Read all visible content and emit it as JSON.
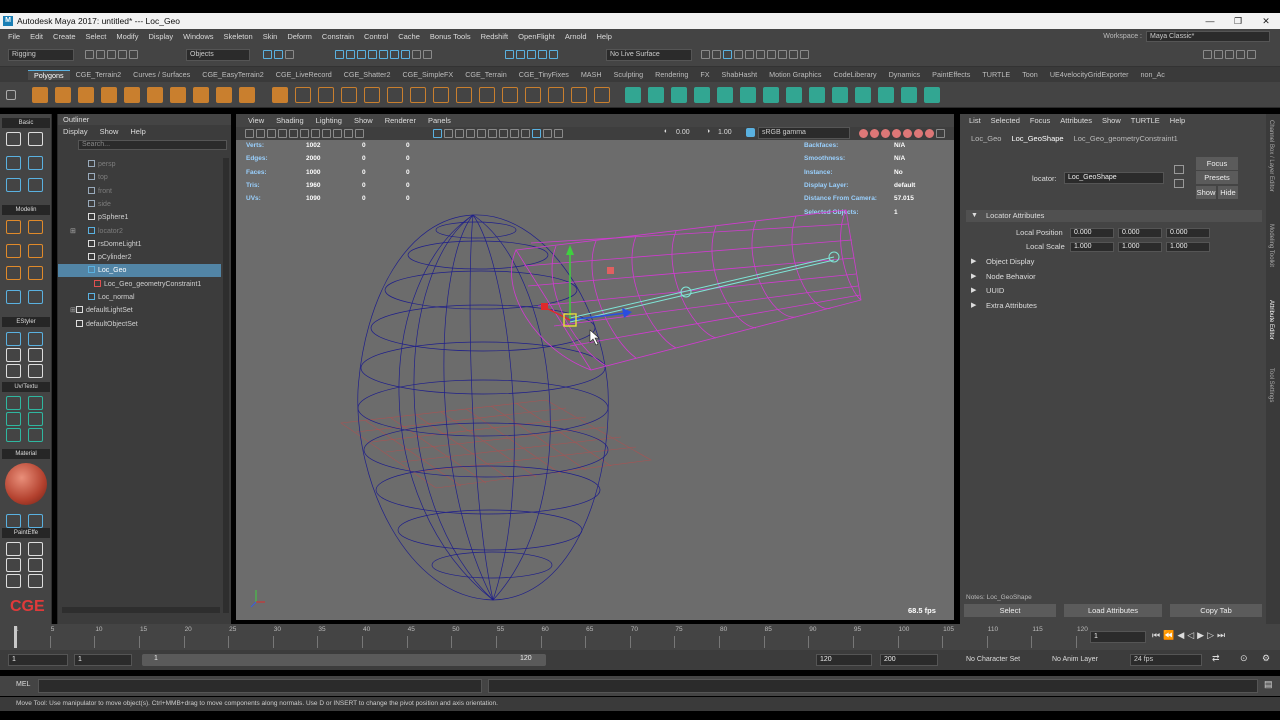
{
  "window": {
    "title": "Autodesk Maya 2017: untitled*   ---   Loc_Geo",
    "controls": [
      "—",
      "❐",
      "✕"
    ]
  },
  "menubar": {
    "items": [
      "File",
      "Edit",
      "Create",
      "Select",
      "Modify",
      "Display",
      "Windows",
      "Skeleton",
      "Skin",
      "Deform",
      "Constrain",
      "Control",
      "Cache",
      "Bonus Tools",
      "Redshift",
      "OpenFlight",
      "Arnold",
      "Help"
    ],
    "workspace_label": "Workspace :",
    "workspace_value": "Maya Classic*"
  },
  "statusline": {
    "mode": "Rigging",
    "selection_mask": "Objects",
    "live_surface": "No Live Surface"
  },
  "shelf": {
    "tabs": [
      "Polygons",
      "CGE_Terrain2",
      "Curves / Surfaces",
      "CGE_EasyTerrain2",
      "CGE_LiveRecord",
      "CGE_Shatter2",
      "CGE_SimpleFX",
      "CGE_Terrain",
      "CGE_TinyFixes",
      "MASH",
      "Sculpting",
      "Rendering",
      "FX",
      "ShabHasht",
      "Motion Graphics",
      "CodeLiberary",
      "Dynamics",
      "PaintEffects",
      "TURTLE",
      "Toon",
      "UE4velocityGridExporter",
      "non_Ac"
    ],
    "active": "Polygons"
  },
  "toolbox": {
    "sections": [
      "Basic",
      "Modelin",
      "EStyler",
      "Uv/Textu",
      "Material",
      "PaintEffe"
    ]
  },
  "outliner": {
    "title": "Outliner",
    "menu": [
      "Display",
      "Show",
      "Help"
    ],
    "search_placeholder": "Search...",
    "rows": [
      {
        "label": "persp",
        "dim": true
      },
      {
        "label": "top",
        "dim": true
      },
      {
        "label": "front",
        "dim": true
      },
      {
        "label": "side",
        "dim": true
      },
      {
        "label": "pSphere1",
        "dim": false
      },
      {
        "label": "locator2",
        "dim": true
      },
      {
        "label": "rsDomeLight1",
        "dim": false
      },
      {
        "label": "pCylinder2",
        "dim": false
      },
      {
        "label": "Loc_Geo",
        "dim": false
      },
      {
        "label": "Loc_Geo_geometryConstraint1",
        "dim": false
      },
      {
        "label": "Loc_normal",
        "dim": false
      },
      {
        "label": "defaultLightSet",
        "dim": false
      },
      {
        "label": "defaultObjectSet",
        "dim": false
      }
    ]
  },
  "viewport": {
    "menu": [
      "View",
      "Shading",
      "Lighting",
      "Show",
      "Renderer",
      "Panels"
    ],
    "exposure": "0.00",
    "gamma": "1.00",
    "color_space": "sRGB gamma",
    "hud_left": [
      {
        "label": "Verts:",
        "a": "1002",
        "b": "0",
        "c": "0"
      },
      {
        "label": "Edges:",
        "a": "2000",
        "b": "0",
        "c": "0"
      },
      {
        "label": "Faces:",
        "a": "1000",
        "b": "0",
        "c": "0"
      },
      {
        "label": "Tris:",
        "a": "1960",
        "b": "0",
        "c": "0"
      },
      {
        "label": "UVs:",
        "a": "1090",
        "b": "0",
        "c": "0"
      }
    ],
    "hud_right": [
      {
        "label": "Backfaces:",
        "value": "N/A"
      },
      {
        "label": "Smoothness:",
        "value": "N/A"
      },
      {
        "label": "Instance:",
        "value": "No"
      },
      {
        "label": "Display Layer:",
        "value": "default"
      },
      {
        "label": "Distance From Camera:",
        "value": "57.015"
      },
      {
        "label": "Selected Objects:",
        "value": "1"
      }
    ],
    "fps": "68.5 fps"
  },
  "attribute_editor": {
    "menu": [
      "List",
      "Selected",
      "Focus",
      "Attributes",
      "Show",
      "TURTLE",
      "Help"
    ],
    "tabs": [
      "Loc_Geo",
      "Loc_GeoShape",
      "Loc_Geo_geometryConstraint1"
    ],
    "active_tab": "Loc_GeoShape",
    "node_label": "locator:",
    "node_value": "Loc_GeoShape",
    "focus": "Focus",
    "presets": "Presets",
    "show": "Show",
    "hide": "Hide",
    "locator_attributes": "Locator Attributes",
    "local_position_label": "Local Position",
    "local_position": [
      "0.000",
      "0.000",
      "0.000"
    ],
    "local_scale_label": "Local Scale",
    "local_scale": [
      "1.000",
      "1.000",
      "1.000"
    ],
    "sections": [
      "Object Display",
      "Node Behavior",
      "UUID",
      "Extra Attributes"
    ],
    "notes": "Notes: Loc_GeoShape",
    "buttons": [
      "Select",
      "Load Attributes",
      "Copy Tab"
    ]
  },
  "side_tabs": [
    "Channel Box / Layer Editor",
    "Modeling Toolkit",
    "Attribute Editor",
    "Tool Settings"
  ],
  "timeslider": {
    "ticks": [
      "1",
      "5",
      "10",
      "15",
      "20",
      "25",
      "30",
      "35",
      "40",
      "45",
      "50",
      "55",
      "60",
      "65",
      "70",
      "75",
      "80",
      "85",
      "90",
      "95",
      "100",
      "105",
      "110",
      "115",
      "120"
    ],
    "current": "1"
  },
  "range": {
    "start": "1",
    "anim_start": "1",
    "slider_start": "1",
    "slider_end": "120",
    "anim_end": "120",
    "end": "200",
    "character_set": "No Character Set",
    "anim_layer": "No Anim Layer",
    "fps": "24 fps"
  },
  "cmdline": {
    "label": "MEL"
  },
  "helpline": "Move Tool: Use manipulator to move object(s). Ctrl+MMB+drag to move components along normals. Use D or INSERT to change the pivot position and axis orientation."
}
